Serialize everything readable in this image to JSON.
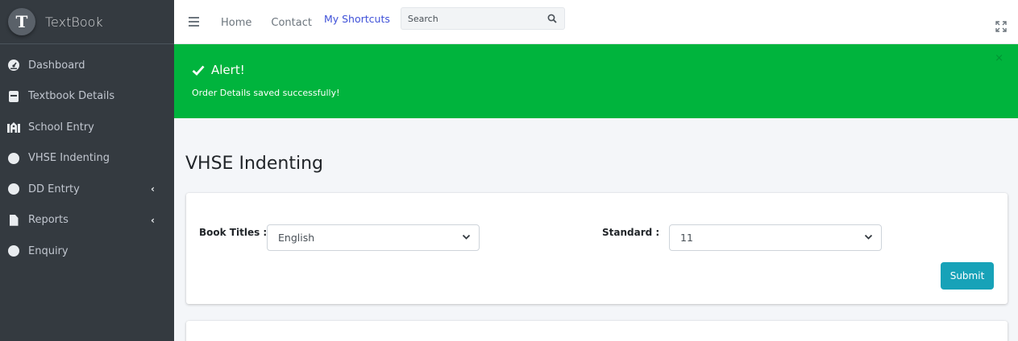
{
  "brand": {
    "name": "TextBook",
    "logo_letter": "T"
  },
  "sidebar": {
    "items": [
      {
        "label": "Dashboard",
        "icon": "dashboard-icon"
      },
      {
        "label": "Textbook Details",
        "icon": "book-icon"
      },
      {
        "label": "School Entry",
        "icon": "school-icon"
      },
      {
        "label": "VHSE Indenting",
        "icon": "circle-icon"
      },
      {
        "label": "DD Entrty",
        "icon": "circle-icon",
        "has_submenu": true
      },
      {
        "label": "Reports",
        "icon": "file-icon",
        "has_submenu": true
      },
      {
        "label": "Enquiry",
        "icon": "circle-icon"
      }
    ]
  },
  "topnav": {
    "home": "Home",
    "contact": "Contact",
    "shortcuts": "My Shortcuts",
    "search_placeholder": "Search"
  },
  "alert": {
    "title": "Alert!",
    "message": "Order Details saved successfully!",
    "close": "×",
    "color": "#00b43d"
  },
  "page": {
    "title": "VHSE Indenting"
  },
  "form": {
    "book_titles_label": "Book Titles :",
    "book_titles_value": "English",
    "standard_label": "Standard :",
    "standard_value": "11",
    "submit_label": "Submit"
  },
  "colors": {
    "sidebar_bg": "#343a40",
    "accent": "#17a2b8",
    "link": "#3f51d8"
  }
}
